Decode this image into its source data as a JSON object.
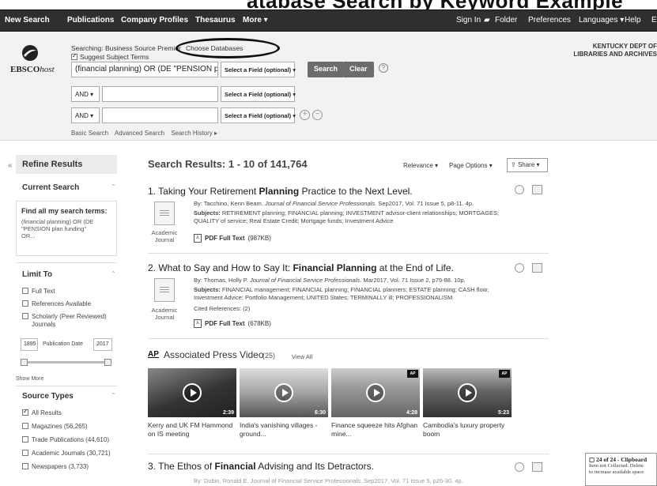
{
  "top_strip": {
    "partial_text": "atabase Search by Keyword Example"
  },
  "nav": {
    "items": [
      "New Search",
      "Publications",
      "Company Profiles",
      "Thesaurus",
      "More ▾"
    ],
    "right": [
      "Sign In",
      "Folder",
      "Preferences",
      "Languages ▾",
      "Help",
      "E"
    ]
  },
  "header": {
    "logo": "EBSCO",
    "logo_suffix": "host",
    "searching": "Searching: Business Source Premier",
    "choose_databases": "Choose Databases",
    "suggest_terms": "Suggest Subject Terms",
    "query_1": "(financial planning)  OR  (DE \"PENSION pla",
    "field_placeholder": "Select a Field (optional) ▾",
    "search_button": "Search",
    "clear_button": "Clear",
    "op_2": "AND ▾",
    "op_3": "AND ▾",
    "query_2": "",
    "query_3": "",
    "links": [
      "Basic Search",
      "Advanced Search",
      "Search History ▸"
    ],
    "institution_line1": "KENTUCKY DEPT OF",
    "institution_line2": "LIBRARIES AND ARCHIVES"
  },
  "refine": {
    "heading": "Refine Results",
    "current_search": "Current Search",
    "find_terms": "Find all my search terms:",
    "terms_text": [
      "(financial planning) OR (DE",
      "\"PENSION plan funding\"",
      "OR..."
    ],
    "limit_to": "Limit To",
    "limits": [
      "Full Text",
      "References Available",
      "Scholarly (Peer Reviewed)",
      "Journals"
    ],
    "date_from": "1895",
    "date_label": "Publication Date",
    "date_to": "2017",
    "show_more": "Show More",
    "source_types": "Source Types",
    "sources": [
      "All Results",
      "Magazines (56,265)",
      "Trade Publications (44,610)",
      "Academic Journals (30,721)",
      "Newspapers (3,733)"
    ]
  },
  "results": {
    "title": "Search Results: 1 - 10 of 141,764",
    "relevance": "Relevance ▾",
    "page_options": "Page Options ▾",
    "share": "Share ▾",
    "r1": {
      "num": "1.",
      "pre": "Taking Your Retirement ",
      "bold": "Planning",
      "post": " Practice to the Next Level.",
      "by_plain": "By: Tacchino, Kenn Beam. ",
      "by_journal": "Journal of Financial Service Professionals",
      "by_rest": ". Sep2017, Vol. 71 Issue 5, p8-11. 4p.",
      "subjects_label": "Subjects: ",
      "subjects_1": "RETIREMENT planning; FINANCIAL planning; INVESTMENT advisor-client relationships; MORTGAGES;",
      "subjects_2": "QUALITY of service; Real Estate Credit; Mortgage funds; Investment Advice",
      "type_1": "Academic",
      "type_2": "Journal",
      "pdf": "PDF Full Text",
      "pdf_size": "(987KB)"
    },
    "r2": {
      "num": "2.",
      "pre": "What to Say and How to Say It: ",
      "bold": "Financial Planning",
      "post": " at the End of Life.",
      "by_plain": "By: Thomas, Holly P. ",
      "by_journal": "Journal of Financial Service Professionals",
      "by_rest": ". Mar2017, Vol. 71 Issue 2, p79-88. 10p.",
      "subjects_label": "Subjects: ",
      "subjects_1": "FINANCIAL management; FINANCIAL planning; FINANCIAL planners; ESTATE planning; CASH flow;",
      "subjects_2": "Investment Advice; Portfolio Management; UNITED States; TERMINALLY ill; PROFESSIONALISM",
      "cited": "Cited References: (2)",
      "type_1": "Academic",
      "type_2": "Journal",
      "pdf": "PDF Full Text",
      "pdf_size": "(678KB)"
    },
    "r3": {
      "num": "3.",
      "pre": "The Ethos of ",
      "bold": "Financial",
      "post": " Advising and Its Detractors.",
      "by_partial": "By: Dubin, Ronald E. Journal of Financial Service Professionals. Sep2017, Vol. 71 Issue 5, p26-30. 4p."
    }
  },
  "ap": {
    "logo": "AP",
    "title": "Associated Press Video",
    "count": "(25)",
    "view_all": "View All",
    "videos": [
      {
        "caption": "Kerry and UK FM Hammond on IS meeting",
        "duration": "2:39"
      },
      {
        "caption": "India's vanishing villages - ground...",
        "duration": "6:30"
      },
      {
        "caption": "Finance squeeze hits Afghan mine...",
        "duration": "4:28"
      },
      {
        "caption": "Cambodia's luxury property boom",
        "duration": "5:23"
      }
    ]
  },
  "clipboard": {
    "title": "24 of 24 - Clipboard",
    "line1": "Item not Collected: Delete",
    "line2": "to increase available space"
  }
}
